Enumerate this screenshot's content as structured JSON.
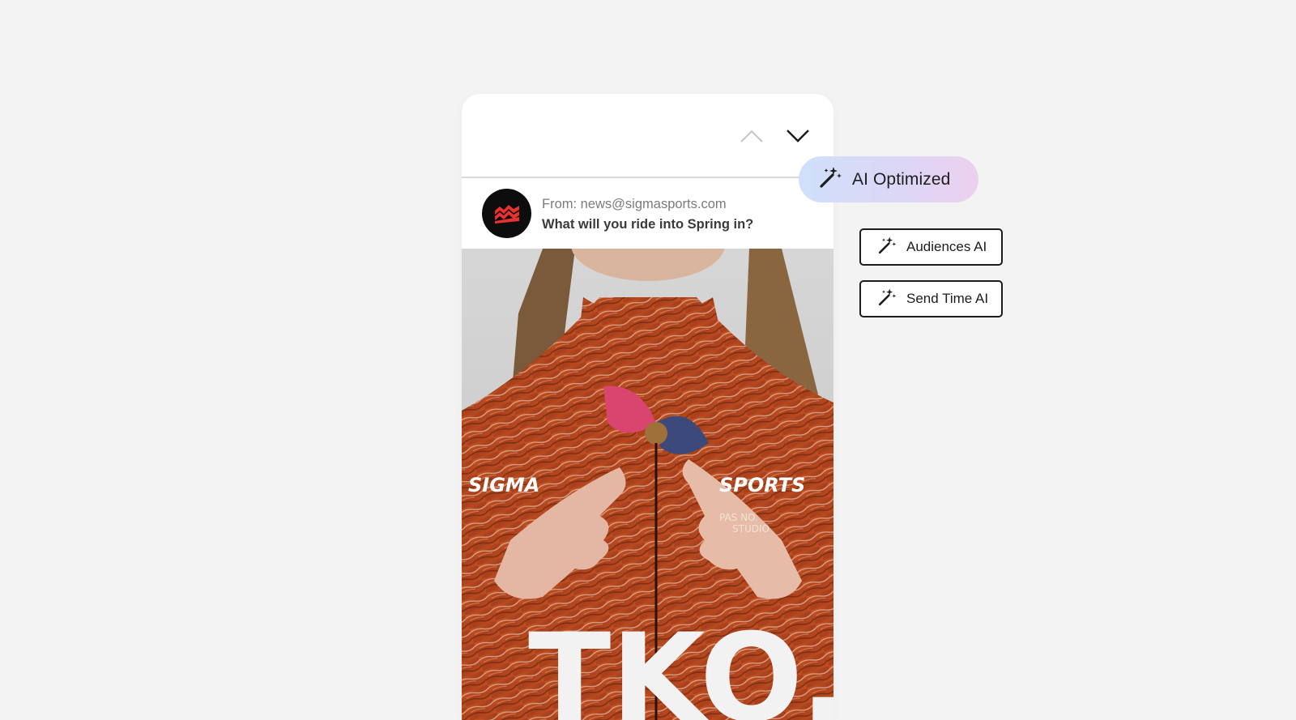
{
  "email": {
    "from": "From: news@sigmasports.com",
    "subject": "What will you ride into Spring in?"
  },
  "hero": {
    "brand_left": "SIGMA",
    "brand_right": "SPORTS",
    "jersey_text_1": "PAS NO.",
    "jersey_text_2": "STUDIO",
    "jersey_big": "TKO."
  },
  "ai_badge": {
    "label": "AI Optimized"
  },
  "features": [
    {
      "label": "Audiences AI"
    },
    {
      "label": "Send Time AI"
    }
  ],
  "icons": {
    "nav_up": "chevron-up-icon",
    "nav_down": "chevron-down-icon",
    "magic": "magic-wand-icon",
    "logo": "sigma-sports-logo"
  },
  "colors": {
    "background": "#f3f3f3",
    "jersey": "#b6491f",
    "logo_red": "#e8322f",
    "pill_gradient_start": "#cfe0fb",
    "pill_gradient_end": "#ecd0ef"
  }
}
